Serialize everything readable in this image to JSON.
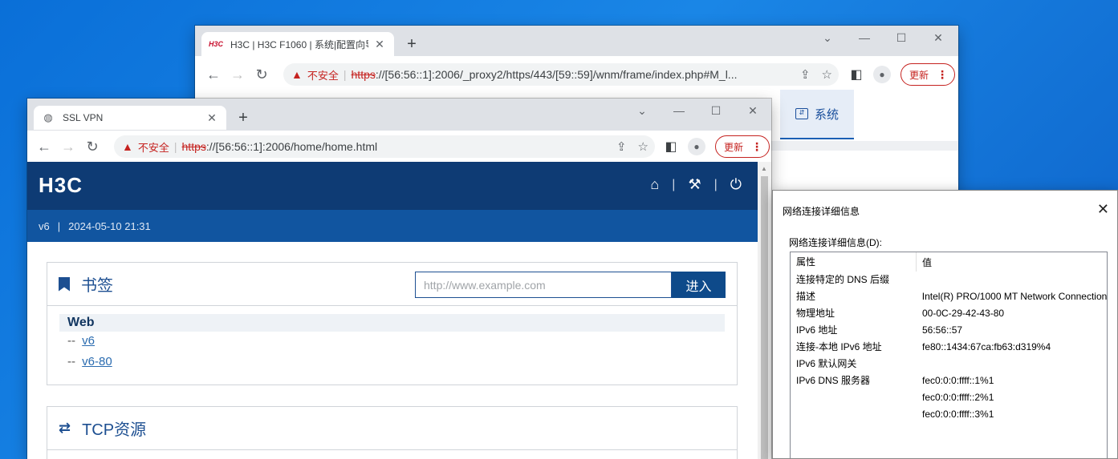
{
  "back_browser": {
    "tab_favicon": "H3C",
    "tab_title": "H3C | H3C F1060 | 系统|配置向导",
    "insecure_label": "不安全",
    "url_scheme": "https",
    "url_rest": "://[56:56::1]:2006/_proxy2/https/443/[59::59]/wnm/frame/index.php#M_l...",
    "update_label": "更新",
    "system_tab_label": "系统",
    "icons": [
      "back-arrow",
      "forward-arrow",
      "reload",
      "warning",
      "share",
      "star",
      "side-panel",
      "profile",
      "more"
    ]
  },
  "front_browser": {
    "tab_title": "SSL VPN",
    "insecure_label": "不安全",
    "url_scheme": "https",
    "url_rest": "://[56:56::1]:2006/home/home.html",
    "update_label": "更新",
    "icons": [
      "globe",
      "back-arrow",
      "forward-arrow",
      "reload",
      "warning",
      "share",
      "star",
      "side-panel",
      "profile",
      "more"
    ]
  },
  "vpn_page": {
    "logo": "H3C",
    "header_icons": [
      "home-icon",
      "wrench-icon",
      "power-icon"
    ],
    "header_separator": "|",
    "user": "v6",
    "separator": "|",
    "datetime": "2024-05-10 21:31",
    "bookmarks": {
      "title": "书签",
      "url_placeholder": "http://www.example.com",
      "go_label": "进入",
      "group": "Web",
      "prefix": "--",
      "links": [
        "v6",
        "v6-80"
      ]
    },
    "tcp": {
      "title": "TCP资源"
    }
  },
  "dialog": {
    "title": "网络连接详细信息",
    "label": "网络连接详细信息(D):",
    "columns": [
      "属性",
      "值"
    ],
    "rows": [
      {
        "prop": "连接特定的 DNS 后缀",
        "value": ""
      },
      {
        "prop": "描述",
        "value": "Intel(R) PRO/1000 MT Network Connection"
      },
      {
        "prop": "物理地址",
        "value": "00-0C-29-42-43-80"
      },
      {
        "prop": "IPv6 地址",
        "value": "56:56::57"
      },
      {
        "prop": "连接-本地 IPv6 地址",
        "value": "fe80::1434:67ca:fb63:d319%4"
      },
      {
        "prop": "IPv6 默认网关",
        "value": ""
      },
      {
        "prop": "IPv6 DNS 服务器",
        "value": "fec0:0:0:ffff::1%1"
      },
      {
        "prop": "",
        "value": "fec0:0:0:ffff::2%1"
      },
      {
        "prop": "",
        "value": "fec0:0:0:ffff::3%1"
      }
    ]
  },
  "colors": {
    "desktop": "#1a86e6",
    "h3c_header": "#0e3b74",
    "h3c_subbar": "#1155a0",
    "insecure_red": "#c5221f",
    "link_blue": "#2b6cb0"
  }
}
